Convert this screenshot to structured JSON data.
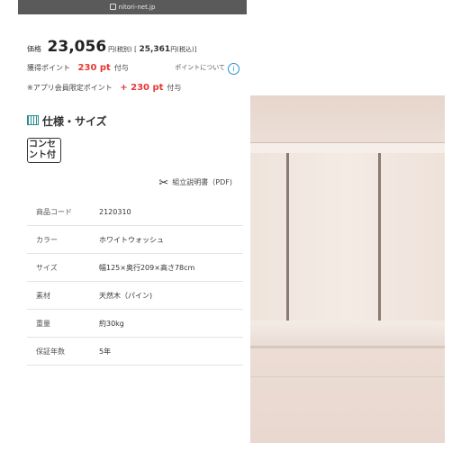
{
  "browser": {
    "url": "nitori-net.jp"
  },
  "price": {
    "label": "価格",
    "main": "23,056",
    "tax_excl": "円(税別)",
    "open_bracket": "[",
    "tax_incl_value": "25,361",
    "tax_incl": "円(税込)",
    "close_bracket": "]"
  },
  "points": {
    "label": "獲得ポイント",
    "value": "230 pt",
    "suffix": "付与",
    "about": "ポイントについて",
    "app_label": "※アプリ会員限定ポイント",
    "app_value": "+ 230 pt",
    "app_suffix": "付与"
  },
  "spec": {
    "heading": "仕様・サイズ",
    "tag": "コンセント付",
    "manual": "組立説明書（PDF)",
    "rows": [
      {
        "key": "商品コード",
        "value": "2120310"
      },
      {
        "key": "カラー",
        "value": "ホワイトウォッシュ"
      },
      {
        "key": "サイズ",
        "value": "幅125×奥行209×高さ78cm"
      },
      {
        "key": "素材",
        "value": "天然木（パイン)"
      },
      {
        "key": "重量",
        "value": "約30kg"
      },
      {
        "key": "保証年数",
        "value": "5年"
      }
    ]
  },
  "icons": {
    "lock": "lock-icon",
    "info": "info-icon",
    "spec": "spec-icon",
    "tool": "tool-icon"
  },
  "colors": {
    "point_red": "#e53935",
    "info_blue": "#2a8fd8"
  }
}
